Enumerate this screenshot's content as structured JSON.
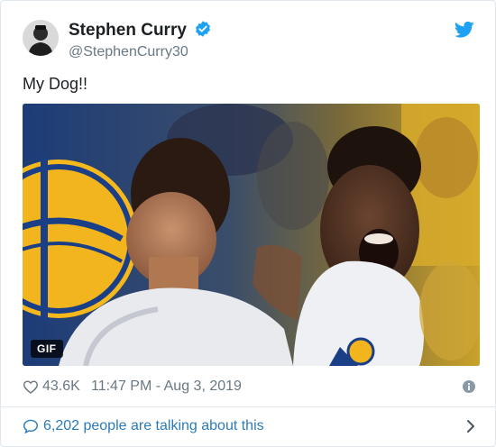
{
  "user": {
    "display_name": "Stephen Curry",
    "handle": "@StephenCurry30",
    "avatar_icon": "avatar-photo",
    "verified_icon": "verified-badge-icon"
  },
  "brand": {
    "logo_icon": "twitter-bird-icon",
    "accent": "#1da1f2"
  },
  "tweet": {
    "text": "My Dog!!",
    "media_badge": "GIF"
  },
  "meta": {
    "like_icon": "heart-icon",
    "like_count": "43.6K",
    "timestamp": "11:47 PM - Aug 3, 2019",
    "info_icon": "info-icon"
  },
  "conversation": {
    "icon": "speech-bubble-icon",
    "text": "6,202 people are talking about this",
    "chevron_icon": "chevron-right-icon",
    "color": "#2b7bb9"
  }
}
